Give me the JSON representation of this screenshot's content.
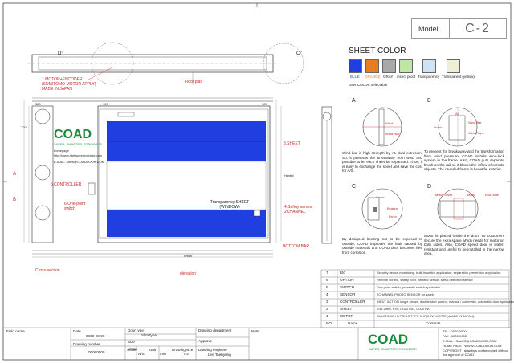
{
  "colors": {
    "blue": "#1f3fe0",
    "orange": "#e87c1e",
    "gray": "#a9a9a9",
    "insect_proof": "#bfe6a6",
    "transparency": "#cfe3f3",
    "transparent_yellow": "#f1eed7",
    "red_annotation": "#c62828",
    "coad_green": "#1a8a3c"
  },
  "model": {
    "label": "Model",
    "value": "C-2"
  },
  "sheet_color": {
    "title": "SHEET COLOR",
    "options": [
      "BLUE",
      "ORANGE",
      "GRAY",
      "insect proof",
      "Transparency",
      "Transparent (yellow)"
    ],
    "note": "User COLOR selectable"
  },
  "drawing": {
    "top_labels": {
      "d": "D°",
      "c": "C°",
      "floor_plan": "Floor plan"
    },
    "motor_note": [
      "1.MOTOR+ENCODER",
      "(SUMITOMO MOTOR APPLY)",
      "MADE IN JAPAN"
    ],
    "dims": {
      "d1": "380",
      "d2": "120",
      "d3": "120",
      "d4": "120",
      "width": "Width",
      "height": "Height"
    },
    "labels": {
      "sheet": "3.SHEET",
      "controller": "5.CONTROLLER",
      "switch": "6.One-point switch",
      "window": "Transparency SHEET (WINDOW)",
      "safety": "4.Safety sensor 2CHANNEL",
      "bottom_bar": "BOTTOM BAR",
      "cross_section": "Cross-section",
      "elevation": "elevation",
      "a": "A",
      "b": "B"
    },
    "panel": {
      "brand": "COAD",
      "tagline": "SAFER, SMARTER, STRONGER",
      "homepage": "homepage",
      "url": "http://www.highspeedrolldoor.com",
      "email": "E-MAIL: sales@COADDOOR.COM"
    }
  },
  "details": {
    "a": {
      "letter": "A",
      "labels": [
        "Wind",
        "Wind+Bar"
      ],
      "text": "Wind-bar is high-strength by AL dual extrusion. So, it prevents the breakaway from wind and possible to let each sheet be separated. Thus, it is easy to exchange the sheet and save the cost for A/S."
    },
    "b": {
      "letter": "B",
      "labels": [
        "Wind-Bar",
        "Brush",
        "AL",
        "Wind Rope"
      ],
      "text": "To prevent the breakaway and the transformation from wind pressure, COAD installs wind-lock system in the frame. Also, COAD puts separate brush on the rail so it blocks the inflow of outside objects. The rounded frame is beautiful exterior."
    },
    "c": {
      "letter": "C",
      "labels": [
        "Cover",
        "Bearing",
        "Drum"
      ],
      "text": "By designed bearing not to be exposed to outside, COAD improves the fault caused by outside materials and COAD door becomes free from corrosion."
    },
    "d": {
      "letter": "D",
      "labels": [
        "Motor cover",
        "Motor",
        "End plate"
      ],
      "text": "Motor is placed inside the drum so customers secure the extra space which needs for motor on both sides. Also, COAD speed door is water-resistant and useful to be installed in the narrow area."
    }
  },
  "parts_table": {
    "rows": [
      {
        "no": "7",
        "name": "Etc",
        "spec": "Security device,monitoring, built-in switch application, separation prevention application"
      },
      {
        "no": "6",
        "name": "OPTION",
        "spec": "Remote control, safety post, infrared sensor, Metal detection sensor"
      },
      {
        "no": "5",
        "name": "SWITCH",
        "spec": "One point switch, proximity switch applicable"
      },
      {
        "no": "4",
        "name": "SENSOR",
        "spec": "2CHANNEL PHOTO SENSOR for safety"
      },
      {
        "no": "3",
        "name": "CONTROLLER",
        "spec": "INPUT ACTION single phase, double start control, manual / automatic, automatic door application"
      },
      {
        "no": "2",
        "name": "SHEET",
        "spec": "Thik 2mm, PVC COATING, COATING"
      },
      {
        "no": "1",
        "name": "MOTOR",
        "spec": "SUMITOMO HYPONIC TYPE 1HP(0.9W MOTOR)MADE IN JAPAN)"
      }
    ],
    "header": {
      "no": "NO",
      "name": "Name",
      "spec": "Contents"
    }
  },
  "title_block": {
    "field_name": "Field name",
    "date_label": "Date",
    "date_value": "0000-00-00",
    "door_type_label": "Door type",
    "door_type_value": "SlimType",
    "size_label": "Size",
    "motor_label": "Motor",
    "drawing_number_label": "Drawing number",
    "drawing_number_value": "00000000",
    "scale_label": "Scale",
    "scale_value": "N/S",
    "unit_label": "Unit",
    "unit_value": "mm",
    "drawing_size_label": "Drawing size",
    "drawing_size_value": "A3",
    "drawing_department_label": "Drawing department",
    "approve_label": "Approve",
    "drawing_engineer_label": "Drawing engineer",
    "drawing_engineer_value": "Lee Taehyung",
    "note_label": "Note",
    "brand": "COAD",
    "tagline": "SAFER, SMARTER, STRONGER",
    "contacts": [
      "TEL : 0000-0000",
      "FAX : 0000-0000",
      "E-MAIL : SALES@COADDOOR.COM",
      "HOME PAGE : WWW.COADDOOR.COM",
      "COPYRIGHT : drawings not be copied without the approval of COAD"
    ]
  }
}
